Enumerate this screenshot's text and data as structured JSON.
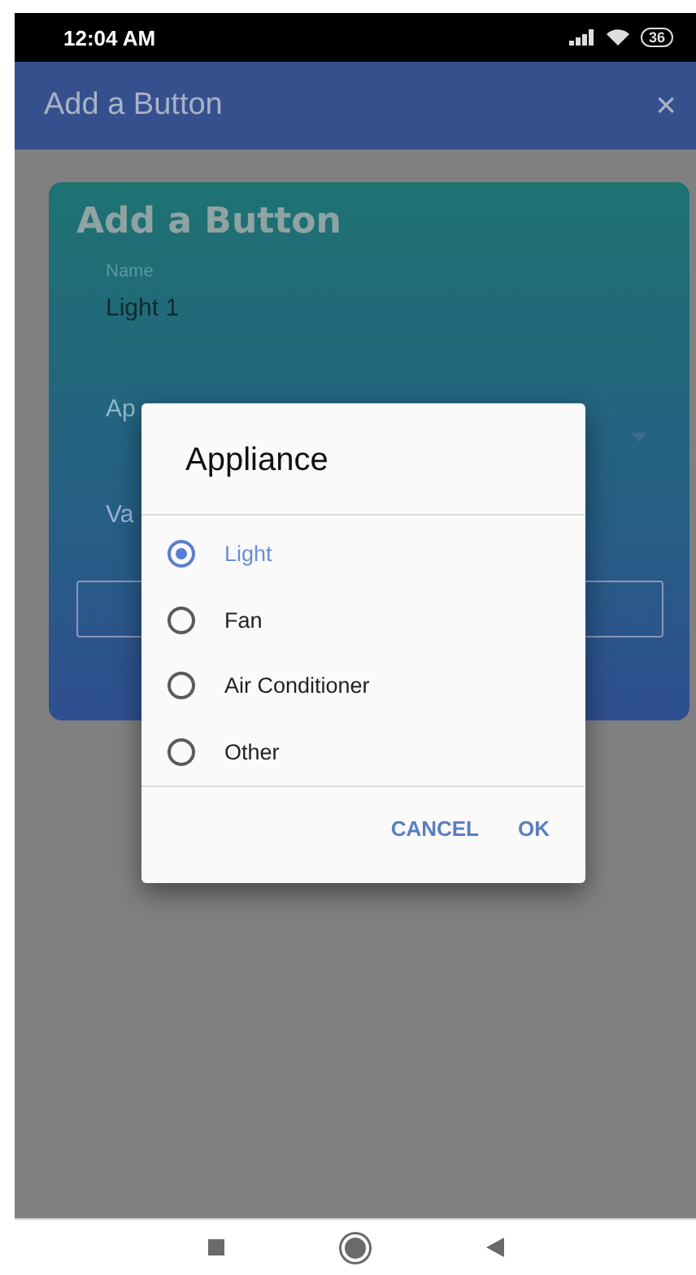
{
  "status_bar": {
    "time": "12:04 AM",
    "battery": "36"
  },
  "app_bar": {
    "title": "Add a Button",
    "close": "×"
  },
  "card": {
    "title": "Add a Button",
    "name_field": {
      "label": "Name",
      "value": "Light 1"
    },
    "appliance_field": {
      "label": "Ap"
    },
    "value_field": {
      "label": "Va"
    }
  },
  "dialog": {
    "title": "Appliance",
    "options": [
      {
        "label": "Light",
        "selected": true
      },
      {
        "label": "Fan",
        "selected": false
      },
      {
        "label": "Air Conditioner",
        "selected": false
      },
      {
        "label": "Other",
        "selected": false
      }
    ],
    "buttons": [
      "CANCEL",
      "OK"
    ]
  }
}
